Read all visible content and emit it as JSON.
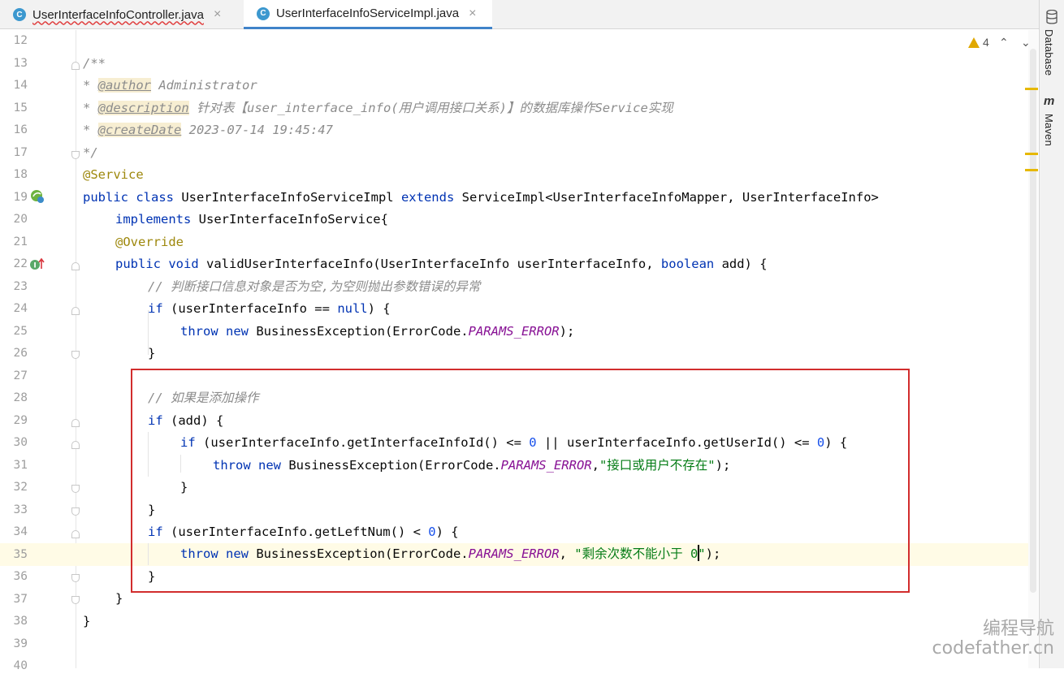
{
  "tabs": [
    {
      "label": "UserInterfaceInfoController.java",
      "icon": "C",
      "close": "×"
    },
    {
      "label": "UserInterfaceInfoServiceImpl.java",
      "icon": "C",
      "close": "×"
    }
  ],
  "tool_windows": {
    "database": "Database",
    "maven": "Maven",
    "maven_icon": "m"
  },
  "inspections": {
    "warning_count": "4",
    "up": "⌃",
    "down": "⌄"
  },
  "lines": {
    "12": "",
    "13": "",
    "14": "",
    "15": "",
    "16": "",
    "17": "",
    "18": "",
    "19": "",
    "20": "",
    "21": "",
    "22": "",
    "23": "",
    "24": "",
    "25": "",
    "26": "",
    "27": "",
    "28": "",
    "29": "",
    "30": "",
    "31": "",
    "32": "",
    "33": "",
    "34": "",
    "35": "",
    "36": "",
    "37": "",
    "38": "",
    "39": "",
    "40": ""
  },
  "code": {
    "l13": "/**",
    "l14_star": "* ",
    "l14_tag": "@author",
    "l14_text": " Administrator",
    "l15_star": "* ",
    "l15_tag": "@description",
    "l15_text": " 针对表【user_interface_info(用户调用接口关系)】的数据库操作Service实现",
    "l16_star": "* ",
    "l16_tag": "@createDate",
    "l16_text": " 2023-07-14 19:45:47",
    "l17": "*/",
    "l18": "@Service",
    "l19_kw1": "public class",
    "l19_name": " UserInterfaceInfoServiceImpl ",
    "l19_kw2": "extends",
    "l19_rest": " ServiceImpl<UserInterfaceInfoMapper, UserInterfaceInfo>",
    "l20_kw": "implements",
    "l20_rest": " UserInterfaceInfoService{",
    "l21": "@Override",
    "l22_kw": "public void",
    "l22_mid": " validUserInterfaceInfo(UserInterfaceInfo userInterfaceInfo, ",
    "l22_kw2": "boolean",
    "l22_rest": " add) {",
    "l23": "// 判断接口信息对象是否为空,为空则抛出参数错误的异常",
    "l24_kw": "if",
    "l24_mid": " (userInterfaceInfo == ",
    "l24_kw2": "null",
    "l24_rest": ") {",
    "l25_kw": "throw new",
    "l25_mid": " BusinessException(ErrorCode.",
    "l25_cst": "PARAMS_ERROR",
    "l25_rest": ");",
    "l26": "}",
    "l28": "// 如果是添加操作",
    "l29_kw": "if",
    "l29_rest": " (add) {",
    "l30_kw": "if",
    "l30_a": " (userInterfaceInfo.getInterfaceInfoId() <= ",
    "l30_n1": "0",
    "l30_b": " || userInterfaceInfo.getUserId() <= ",
    "l30_n2": "0",
    "l30_c": ") {",
    "l31_kw": "throw new",
    "l31_mid": " BusinessException(ErrorCode.",
    "l31_cst": "PARAMS_ERROR",
    "l31_comma": ",",
    "l31_str": "\"接口或用户不存在\"",
    "l31_rest": ");",
    "l32": "}",
    "l33": "}",
    "l34_kw": "if",
    "l34_a": " (userInterfaceInfo.getLeftNum() < ",
    "l34_n": "0",
    "l34_b": ") {",
    "l35_kw": "throw new",
    "l35_mid": " BusinessException(ErrorCode.",
    "l35_cst": "PARAMS_ERROR",
    "l35_comma": ", ",
    "l35_str1": "\"剩余次数不能小于 0",
    "l35_str2": "\"",
    "l35_rest": ");",
    "l36": "}",
    "l37": "}",
    "l38": "}"
  },
  "watermark": {
    "line1": "编程导航",
    "line2": "codefather.cn"
  },
  "colors": {
    "keyword": "#0033b3",
    "annotation": "#9e880d",
    "string": "#067d17",
    "number": "#1750eb",
    "constant": "#871094",
    "comment": "#8c8c8c",
    "highlight_box": "#d22d2d",
    "tab_underline": "#4083c9"
  }
}
